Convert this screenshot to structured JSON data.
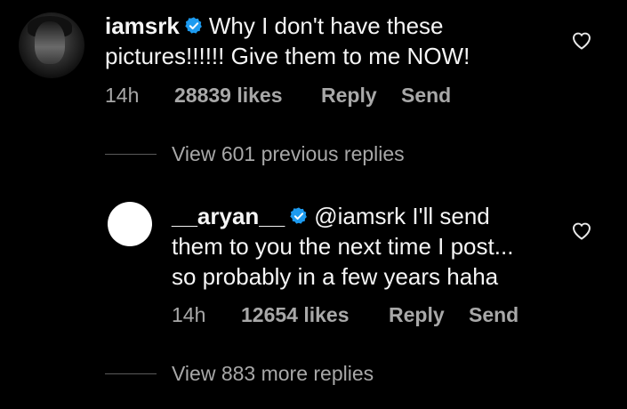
{
  "comment": {
    "username": "iamsrk",
    "text_line1": "Why I don't have these",
    "text_line2": "pictures!!!!!! Give them to me NOW!",
    "time": "14h",
    "likes": "28839 likes",
    "reply_label": "Reply",
    "send_label": "Send"
  },
  "view_previous": "View 601 previous replies",
  "reply": {
    "username": "__aryan__",
    "mention": "@iamsrk",
    "text_line1_rest": " I'll send",
    "text_line2": "them to you the next time I post...",
    "text_line3": "so probably in a few years haha",
    "time": "14h",
    "likes": "12654 likes",
    "reply_label": "Reply",
    "send_label": "Send"
  },
  "view_more": "View 883 more replies",
  "colors": {
    "background": "#000000",
    "text": "#f5f5f5",
    "secondary": "#a8a8a8",
    "verified": "#1d9bf0"
  }
}
